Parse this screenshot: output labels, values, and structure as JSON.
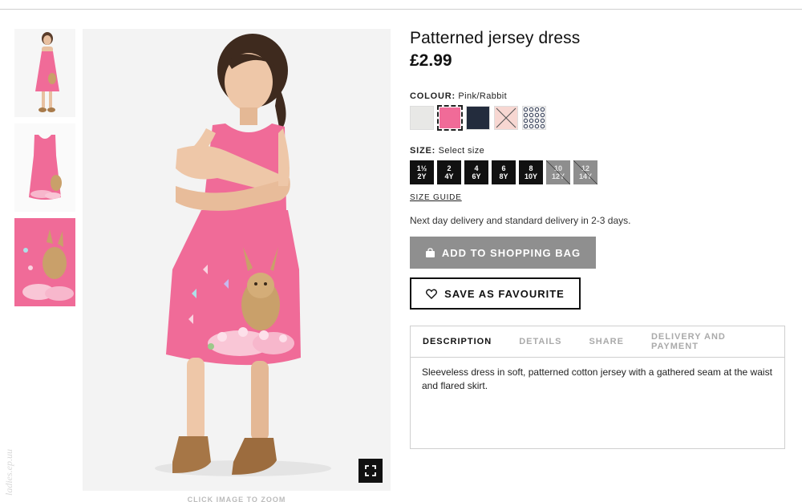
{
  "product": {
    "title": "Patterned jersey dress",
    "price": "£2.99"
  },
  "colour": {
    "label": "COLOUR:",
    "selected": "Pink/Rabbit",
    "swatches": [
      {
        "name": "light grey",
        "color": "#e8e8e6"
      },
      {
        "name": "pink",
        "color": "#f06b98"
      },
      {
        "name": "dark blue",
        "color": "#232c3d"
      },
      {
        "name": "light pink",
        "color": "#f7d7d2"
      },
      {
        "name": "patterned",
        "color": "#9aa0a8"
      }
    ]
  },
  "size": {
    "label": "SIZE:",
    "placeholder": "Select size",
    "options": [
      {
        "top": "1½",
        "bottom": "2Y",
        "available": true
      },
      {
        "top": "2",
        "bottom": "4Y",
        "available": true
      },
      {
        "top": "4",
        "bottom": "6Y",
        "available": true
      },
      {
        "top": "6",
        "bottom": "8Y",
        "available": true
      },
      {
        "top": "8",
        "bottom": "10Y",
        "available": true
      },
      {
        "top": "10",
        "bottom": "12Y",
        "available": false
      },
      {
        "top": "12",
        "bottom": "14Y",
        "available": false
      }
    ],
    "guide_label": "SIZE GUIDE"
  },
  "delivery_text": "Next day delivery and standard delivery in 2-3 days.",
  "buttons": {
    "add_to_bag": "ADD TO SHOPPING BAG",
    "save_favourite": "SAVE AS FAVOURITE"
  },
  "tabs": {
    "items": [
      "DESCRIPTION",
      "DETAILS",
      "SHARE",
      "DELIVERY AND PAYMENT"
    ],
    "active": "DESCRIPTION",
    "description": "Sleeveless dress in soft, patterned cotton jersey with a gathered seam at the waist and flared skirt."
  },
  "gallery": {
    "zoom_caption": "CLICK IMAGE TO ZOOM",
    "watermark": "ladies.ep.uu"
  },
  "colors": {
    "dress_pink": "#f06b98",
    "button_grey": "#8f8f8f"
  }
}
